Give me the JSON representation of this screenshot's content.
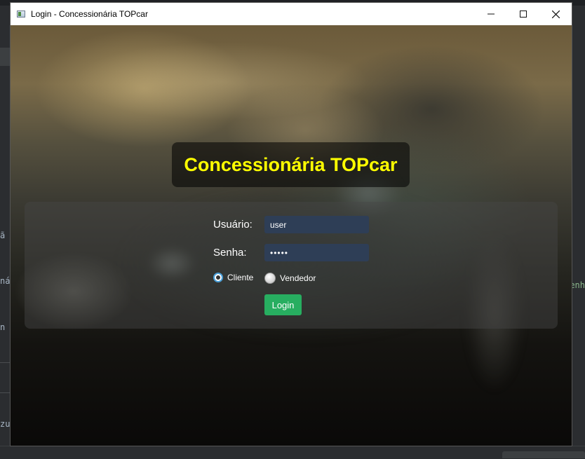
{
  "window": {
    "title": "Login - Concessionária TOPcar",
    "controls": {
      "minimize_icon": "minimize-icon",
      "maximize_icon": "maximize-icon",
      "close_icon": "close-icon"
    }
  },
  "header": {
    "title": "Concessionária TOPcar",
    "title_color": "#ffff00"
  },
  "form": {
    "user_label": "Usuário:",
    "user_value": "user",
    "password_label": "Senha:",
    "password_value": "•••••",
    "radio_cliente": {
      "label": "Cliente",
      "checked": true
    },
    "radio_vendedor": {
      "label": "Vendedor",
      "checked": false
    },
    "login_label": "Login",
    "login_color": "#27ae60"
  },
  "background": {
    "left_fragments": [
      "ã",
      "ná",
      "n",
      "zu"
    ],
    "right_fragments": [
      "enh"
    ]
  }
}
